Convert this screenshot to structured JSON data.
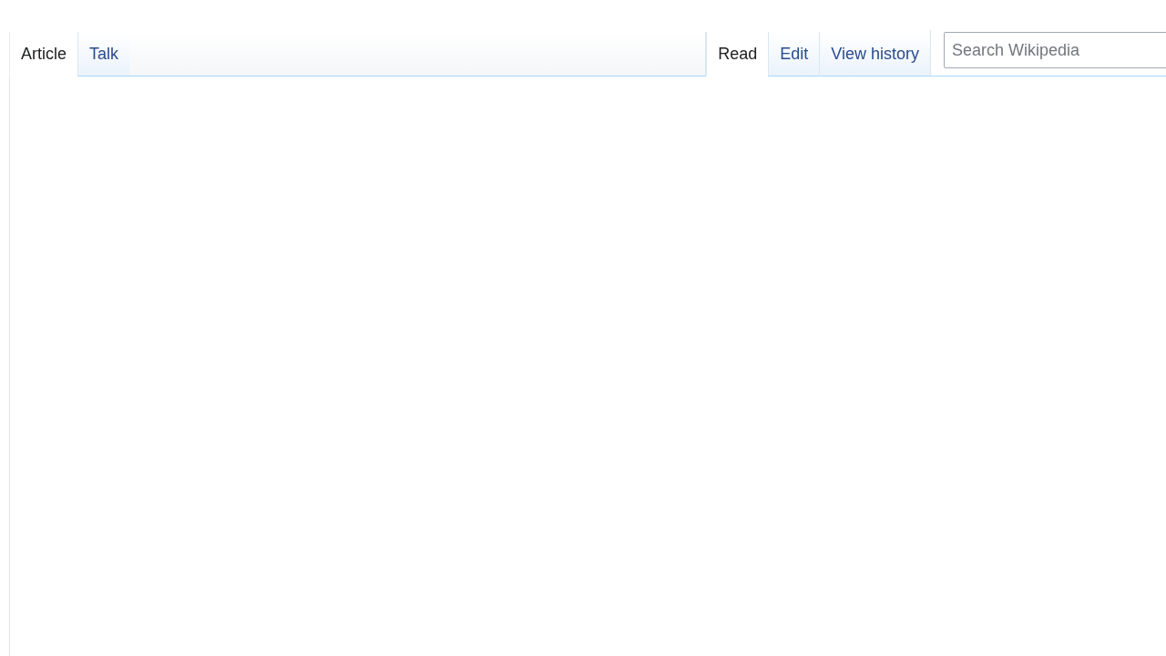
{
  "namespace_tabs": [
    {
      "label": "Article",
      "selected": true
    },
    {
      "label": "Talk",
      "selected": false
    }
  ],
  "view_tabs": [
    {
      "label": "Read",
      "selected": true
    },
    {
      "label": "Edit",
      "selected": false
    },
    {
      "label": "View history",
      "selected": false
    }
  ],
  "search": {
    "placeholder": "Search Wikipedia"
  }
}
